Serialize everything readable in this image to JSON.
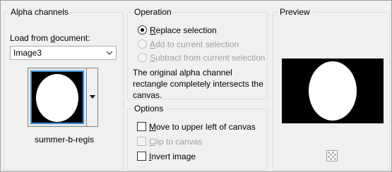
{
  "alpha": {
    "title": "Alpha channels",
    "load_label_pre": "Load from ",
    "load_label_ul": "d",
    "load_label_post": "ocument:",
    "document_value": "Image3",
    "channel_name": "summer-b-regis"
  },
  "operation": {
    "title": "Operation",
    "replace": {
      "ul": "R",
      "rest": "eplace selection",
      "checked": true,
      "enabled": true
    },
    "add": {
      "ul": "A",
      "rest": "dd to current selection",
      "checked": false,
      "enabled": false
    },
    "subtract": {
      "ul": "S",
      "rest": "ubtract from current selection",
      "checked": false,
      "enabled": false
    },
    "description": "The original alpha channel rectangle completely intersects the canvas."
  },
  "options": {
    "title": "Options",
    "move": {
      "ul": "M",
      "rest": "ove to upper left of canvas",
      "checked": false,
      "enabled": true
    },
    "clip": {
      "ul": "C",
      "rest": "lip to canvas",
      "checked": false,
      "enabled": false
    },
    "invert": {
      "ul": "I",
      "rest": "nvert image",
      "checked": false,
      "enabled": true
    }
  },
  "preview": {
    "title": "Preview"
  },
  "icons": {
    "dropdown": "chevron-down-icon",
    "picker": "triangle-down-icon",
    "zoom": "checker-zoom-icon"
  }
}
